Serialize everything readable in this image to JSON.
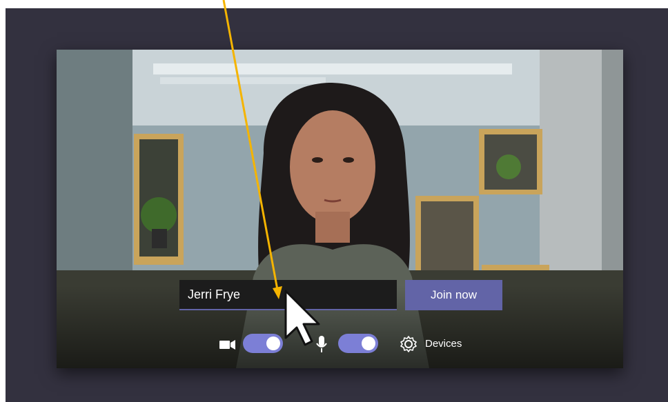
{
  "join": {
    "name_value": "Jerri Frye",
    "join_label": "Join now"
  },
  "controls": {
    "camera_icon": "video-camera-icon",
    "camera_on": true,
    "mic_icon": "microphone-icon",
    "mic_on": true,
    "devices_icon": "gear-icon",
    "devices_label": "Devices"
  },
  "colors": {
    "accent": "#6264a7",
    "toggle_on": "#7c7fd6",
    "frame_background": "#33313f",
    "annotation_arrow": "#f5b400"
  }
}
